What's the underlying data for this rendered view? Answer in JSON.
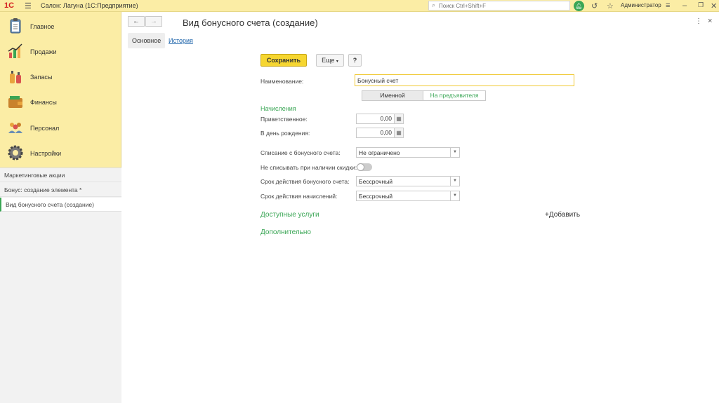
{
  "topbar": {
    "logo": "1С",
    "app_title": "Салон: Лагуна  (1С:Предприятие)",
    "search_placeholder": "Поиск Ctrl+Shift+F",
    "user": "Администратор"
  },
  "sidebar": {
    "items": [
      {
        "label": "Главное",
        "icon": "clipboard-icon"
      },
      {
        "label": "Продажи",
        "icon": "chart-icon"
      },
      {
        "label": "Запасы",
        "icon": "bottles-icon"
      },
      {
        "label": "Финансы",
        "icon": "wallet-icon"
      },
      {
        "label": "Персонал",
        "icon": "people-icon"
      },
      {
        "label": "Настройки",
        "icon": "gear-icon"
      }
    ],
    "open_windows": [
      "Маркетинговые акции",
      "Бонус: создание элемента *",
      "Вид бонусного счета (создание)"
    ]
  },
  "main": {
    "title": "Вид бонусного счета (создание)",
    "tabs": [
      "Основное",
      "История"
    ],
    "toolbar": {
      "save": "Сохранить",
      "more": "Еще",
      "help": "?"
    },
    "form": {
      "name_label": "Наименование:",
      "name_value": "Бонусный счет",
      "seg_left": "Именной",
      "seg_right": "На предъявителя",
      "section_accruals": "Начисления",
      "welcome_label": "Приветственное:",
      "welcome_value": "0,00",
      "birthday_label": "В день рождения:",
      "birthday_value": "0,00",
      "writeoff_label": "Списание с бонусного счета:",
      "writeoff_value": "Не ограничено",
      "no_writeoff_label": "Не списывать при наличии скидки:",
      "validity_label": "Срок действия бонусного счета:",
      "validity_value": "Бессрочный",
      "accrual_validity_label": "Срок действия начислений:",
      "accrual_validity_value": "Бессрочный"
    },
    "groups": {
      "services": "Доступные услуги",
      "add": "+Добавить",
      "extra": "Дополнительно"
    }
  },
  "colors": {
    "sidebar_bg": "#fbeda5",
    "accent_green": "#3aa655",
    "save_yellow": "#f6d630",
    "link_blue": "#1b62a9"
  }
}
